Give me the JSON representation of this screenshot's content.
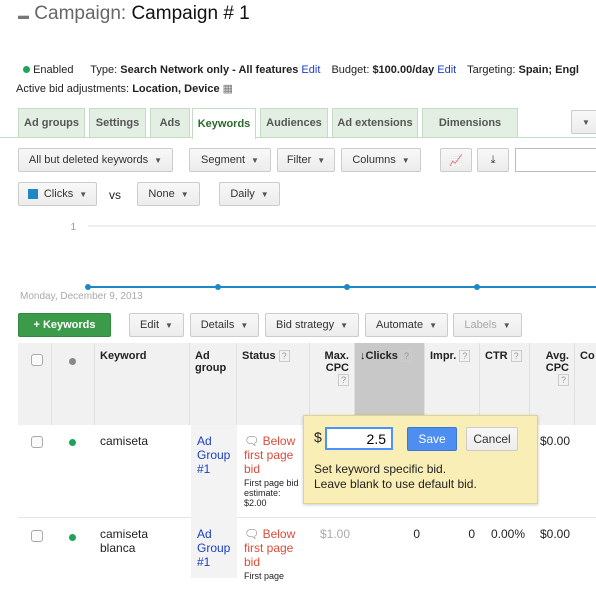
{
  "header": {
    "label": "Campaign:",
    "name": "Campaign # 1"
  },
  "summary": {
    "status": "Enabled",
    "type_label": "Type:",
    "type_value": "Search Network only - All features",
    "edit": "Edit",
    "budget_label": "Budget:",
    "budget_value": "$100.00/day",
    "targeting_label": "Targeting:",
    "targeting_value": "Spain; Engl",
    "bid_adj_label": "Active bid adjustments:",
    "bid_adj_value": "Location, Device"
  },
  "tabs": [
    {
      "label": "Ad groups"
    },
    {
      "label": "Settings"
    },
    {
      "label": "Ads"
    },
    {
      "label": "Keywords",
      "active": true
    },
    {
      "label": "Audiences"
    },
    {
      "label": "Ad extensions"
    },
    {
      "label": "Dimensions"
    }
  ],
  "toolbar": {
    "filter_view": "All but deleted keywords",
    "segment": "Segment",
    "filter": "Filter",
    "columns": "Columns"
  },
  "chart_controls": {
    "metric1": "Clicks",
    "metric1_color": "#1e88c7",
    "vs": "vs",
    "metric2": "None",
    "period": "Daily"
  },
  "chart": {
    "y_max_label": "1",
    "date_label": "Monday, December 9, 2013",
    "line_color": "#1e88c7"
  },
  "actions": {
    "add": "+ Keywords",
    "edit": "Edit",
    "details": "Details",
    "bid_strategy": "Bid strategy",
    "automate": "Automate",
    "labels": "Labels"
  },
  "table": {
    "headers": {
      "keyword": "Keyword",
      "ad_group": "Ad group",
      "status": "Status",
      "max_cpc": "Max. CPC",
      "clicks": "Clicks",
      "impr": "Impr.",
      "ctr": "CTR",
      "avg_cpc": "Avg. CPC",
      "cost": "Co"
    },
    "help": "?",
    "rows": [
      {
        "keyword": "camiseta",
        "ad_group": "Ad Group #1",
        "status": "Below first page bid",
        "estimate": "First page bid estimate: $2.00",
        "max_cpc": "",
        "clicks": "",
        "impr": "",
        "ctr": "",
        "avg_cpc": "$0.00"
      },
      {
        "keyword": "camiseta blanca",
        "ad_group": "Ad Group #1",
        "status": "Below first page bid",
        "estimate": "First page",
        "max_cpc": "$1.00",
        "clicks": "0",
        "impr": "0",
        "ctr": "0.00%",
        "avg_cpc": "$0.00"
      }
    ]
  },
  "popup": {
    "currency": "$",
    "value": "2.5",
    "save": "Save",
    "cancel": "Cancel",
    "hint1": "Set keyword specific bid.",
    "hint2": "Leave blank to use default bid."
  }
}
